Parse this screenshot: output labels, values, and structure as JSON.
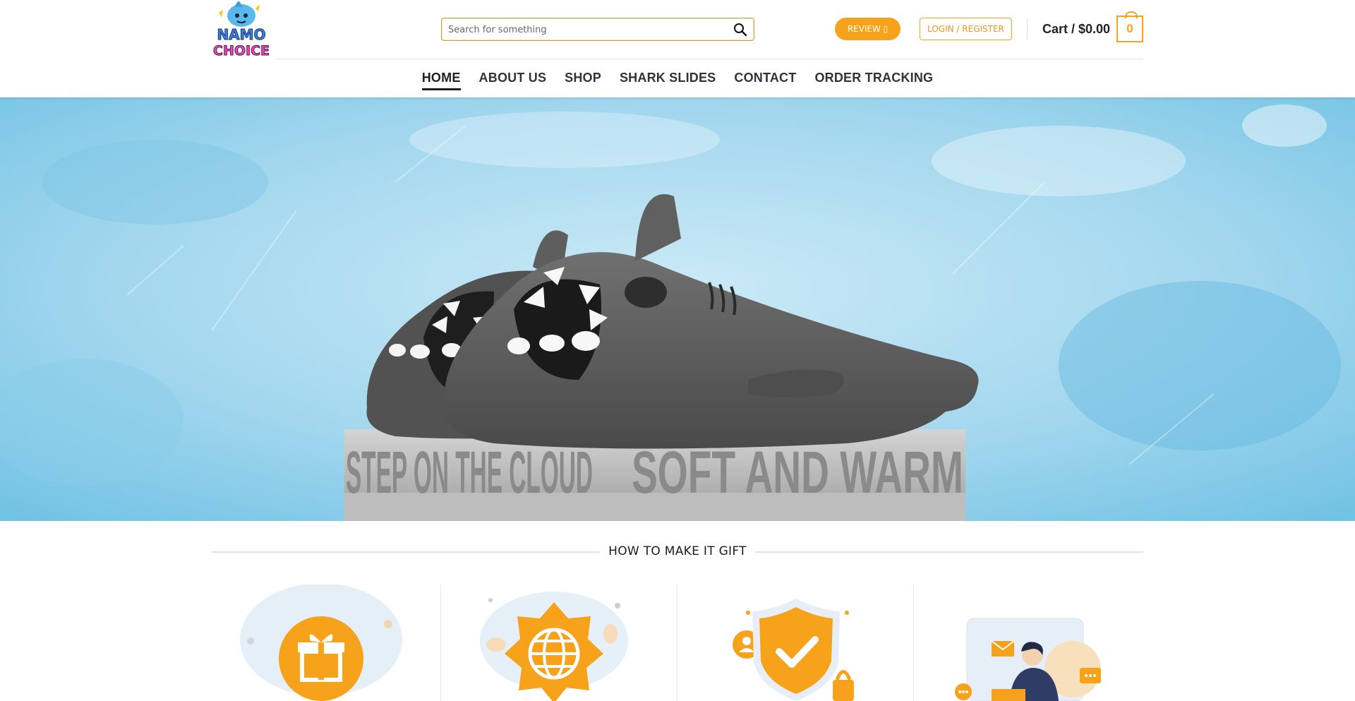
{
  "header": {
    "logo_text_top": "NAMO",
    "logo_text_bottom": "CHOICE",
    "search_placeholder": "Search for something",
    "review_label": "REVIEW ▯",
    "login_label": "LOGIN / REGISTER",
    "cart_label": "Cart / $0.00",
    "cart_count": "0"
  },
  "nav": {
    "items": [
      "HOME",
      "ABOUT US",
      "SHOP",
      "SHARK SLIDES",
      "CONTACT",
      "ORDER TRACKING"
    ],
    "active": "HOME"
  },
  "hero": {
    "box_text_left": "STEP ON THE CLOUD",
    "box_text_right": "SOFT AND WARM"
  },
  "section": {
    "title": "HOW TO MAKE IT GIFT",
    "feature_icons": [
      "gift-icon",
      "globe-icon",
      "shield-check-icon",
      "person-laptop-icon"
    ]
  },
  "colors": {
    "accent": "#f7a21b",
    "hero_bg": "#a9dbee",
    "slide_gray": "#5a5a5a",
    "text_dark": "#222222"
  }
}
